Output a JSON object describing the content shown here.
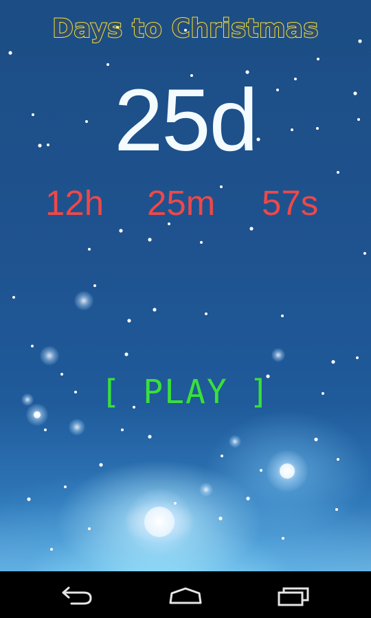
{
  "app": {
    "title": "Days to Christmas",
    "days": "25d",
    "hours": "12h",
    "minutes": "25m",
    "seconds": "57s",
    "play_label": "[ PLAY ]"
  },
  "colors": {
    "title_fill": "#2f4c70",
    "title_outline": "#f4e33a",
    "days": "#f3fbff",
    "hms": "#ef4848",
    "play": "#39e03a"
  },
  "navbar": {
    "icons": [
      "back-icon",
      "home-icon",
      "recent-apps-icon"
    ]
  }
}
